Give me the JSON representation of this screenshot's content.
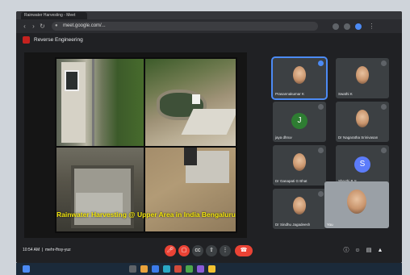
{
  "browser": {
    "tab_title": "Rainwater Harvesting - Meet",
    "url": "meet.google.com/..."
  },
  "meet": {
    "title": "Reverse Engineering",
    "slide_caption": "Rainwater Harvesting @ Upper Area in India Bengaluru",
    "meeting_code": "mehr-fhsy-yuz",
    "time": "10:54 AM"
  },
  "participants": [
    {
      "name": "Prasannakumar K",
      "kind": "face",
      "active": true
    },
    {
      "name": "Swathi K",
      "kind": "face"
    },
    {
      "name": "jaya dhruv",
      "kind": "letter",
      "letter": "J",
      "color": "#2e7d32"
    },
    {
      "name": "Dr Nagaratha Srinivasan",
      "kind": "face"
    },
    {
      "name": "Dr Ganapati G Bhat",
      "kind": "face"
    },
    {
      "name": "Shruthi B S",
      "kind": "letter",
      "letter": "S",
      "color": "#5c7cfa"
    },
    {
      "name": "Dr Sindhu Jagadeesh",
      "kind": "face"
    }
  ],
  "self_view": {
    "name": "You"
  },
  "controls": {
    "mic": "mic-off-icon",
    "camera": "camera-off-icon",
    "captions": "captions-icon",
    "present": "present-icon",
    "more": "more-icon",
    "end_call": "end-call-icon",
    "colors": {
      "red": "#ea4335",
      "gray": "#3c4043",
      "blue": "#4c8bf5"
    }
  }
}
